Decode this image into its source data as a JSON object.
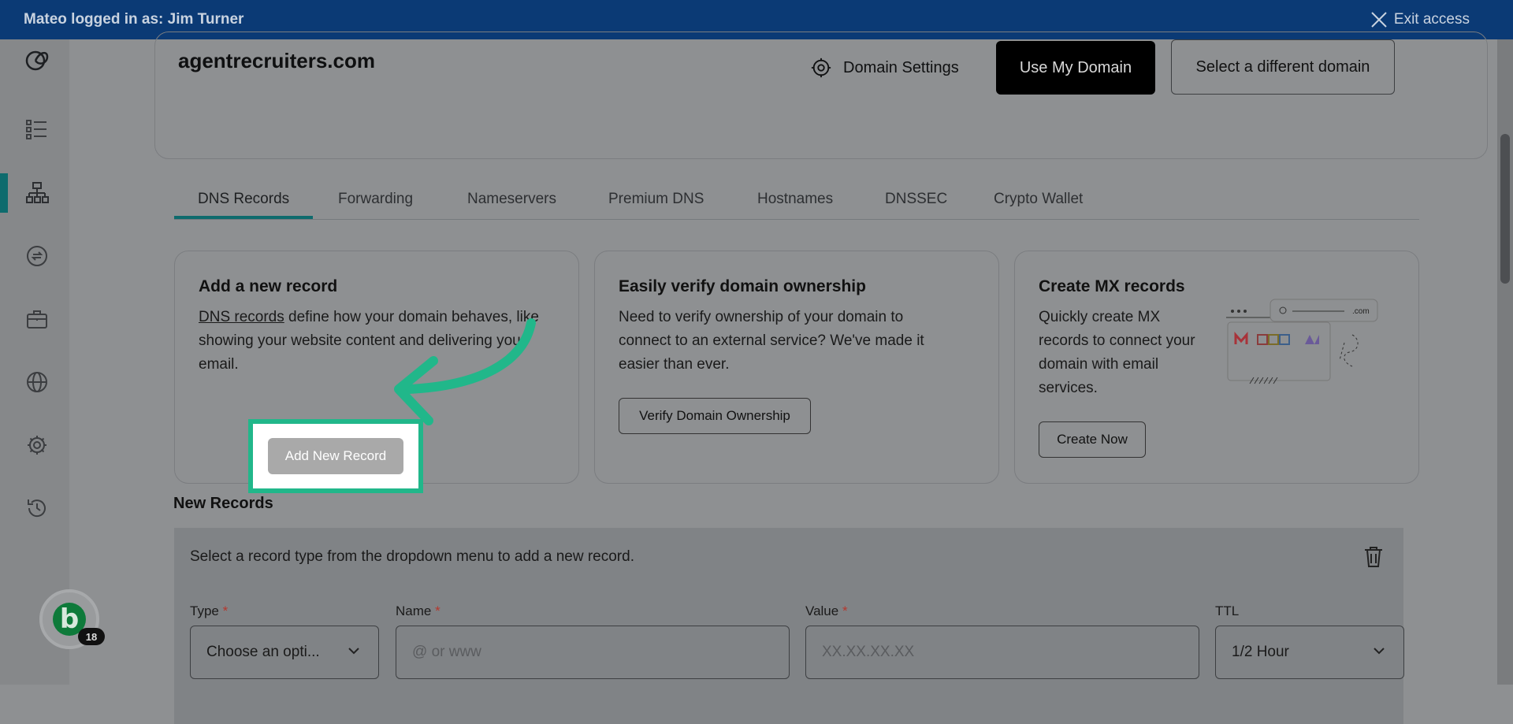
{
  "topbar": {
    "logged_in_text": "Mateo logged in as: Jim Turner",
    "exit_label": "Exit access"
  },
  "sidebar": {
    "items": [
      {
        "icon": "logo-icon"
      },
      {
        "icon": "list-icon"
      },
      {
        "icon": "dns-network-icon",
        "active": true
      },
      {
        "icon": "transfer-icon"
      },
      {
        "icon": "briefcase-icon"
      },
      {
        "icon": "globe-icon"
      },
      {
        "icon": "gear-icon"
      },
      {
        "icon": "history-icon"
      }
    ]
  },
  "domain": {
    "name": "agentrecruiters.com",
    "settings_label": "Domain Settings",
    "use_label": "Use My Domain",
    "select_label": "Select a different domain"
  },
  "tabs": [
    "DNS Records",
    "Forwarding",
    "Nameservers",
    "Premium DNS",
    "Hostnames",
    "DNSSEC",
    "Crypto Wallet"
  ],
  "cards": {
    "add_record": {
      "title": "Add a new record",
      "link": "DNS records",
      "text_line1_rest": " define how your domain behaves, like",
      "text_line2": "showing your website content and delivering your",
      "text_line3": "email.",
      "button": "Add New Record"
    },
    "verify": {
      "title": "Easily verify domain ownership",
      "line1": "Need to verify ownership of your domain to",
      "line2": "connect to an external service? We've made it",
      "line3": "easier than ever.",
      "button": "Verify Domain Ownership"
    },
    "mx": {
      "title": "Create MX records",
      "line1": "Quickly create MX",
      "line2": "records to connect your",
      "line3": "domain with email",
      "line4": "services.",
      "button": "Create Now",
      "illustration_text": ".com"
    }
  },
  "new_records": {
    "title": "New Records",
    "description": "Select a record type from the dropdown menu to add a new record.",
    "fields": {
      "type_label": "Type",
      "type_value": "Choose an opti...",
      "name_label": "Name",
      "name_placeholder": "@ or www",
      "value_label": "Value",
      "value_placeholder": "XX.XX.XX.XX",
      "ttl_label": "TTL",
      "ttl_value": "1/2 Hour",
      "required_mark": "*"
    }
  },
  "avatar": {
    "letter": "b",
    "badge_count": "18"
  },
  "colors": {
    "highlight": "#21b78a",
    "accent": "#0e6b6d",
    "topbar": "#0b3a75"
  }
}
